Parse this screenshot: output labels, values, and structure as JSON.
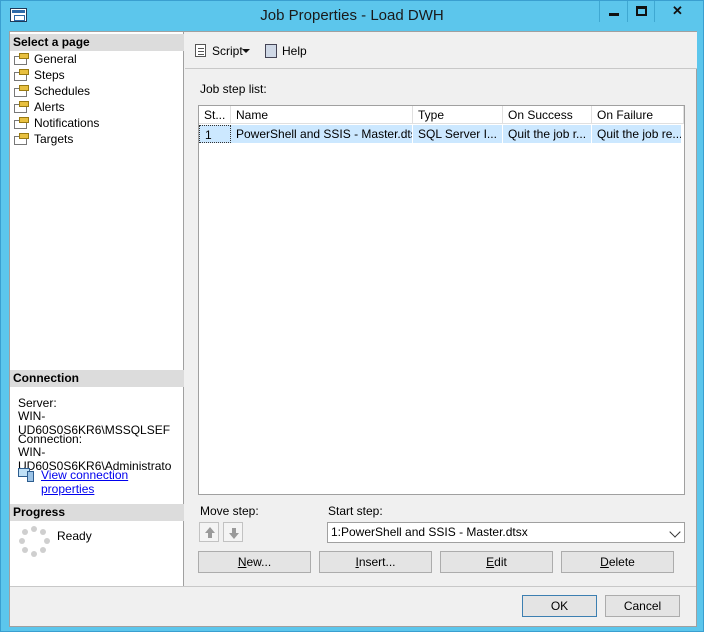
{
  "window": {
    "title": "Job Properties - Load DWH",
    "controls": {
      "minimize": "minimize",
      "maximize": "maximize",
      "close": "✕"
    }
  },
  "left": {
    "select_header": "Select a page",
    "pages": [
      "General",
      "Steps",
      "Schedules",
      "Alerts",
      "Notifications",
      "Targets"
    ],
    "connection_header": "Connection",
    "server_label": "Server:",
    "server_value": "WIN-UD60S0S6KR6\\MSSQLSEF",
    "connection_label": "Connection:",
    "connection_value": "WIN-UD60S0S6KR6\\Administrato",
    "view_connection_link": "View connection properties",
    "progress_header": "Progress",
    "progress_status": "Ready"
  },
  "toolbar": {
    "script_label": "Script",
    "help_label": "Help"
  },
  "steps": {
    "list_label": "Job step list:",
    "columns": [
      "St...",
      "Name",
      "Type",
      "On Success",
      "On Failure"
    ],
    "rows": [
      [
        "1",
        "PowerShell and SSIS - Master.dtsx",
        "SQL Server I...",
        "Quit the job r...",
        "Quit the job re..."
      ]
    ],
    "move_label": "Move step:",
    "start_label": "Start step:",
    "start_value": "1:PowerShell and SSIS - Master.dtsx",
    "buttons": {
      "new": "New...",
      "insert": "Insert...",
      "edit": "Edit",
      "delete": "Delete"
    }
  },
  "footer": {
    "ok": "OK",
    "cancel": "Cancel"
  },
  "colors": {
    "titlebar": "#5cc6ec",
    "selected_row": "#cce8ff",
    "link": "#0000ee"
  }
}
